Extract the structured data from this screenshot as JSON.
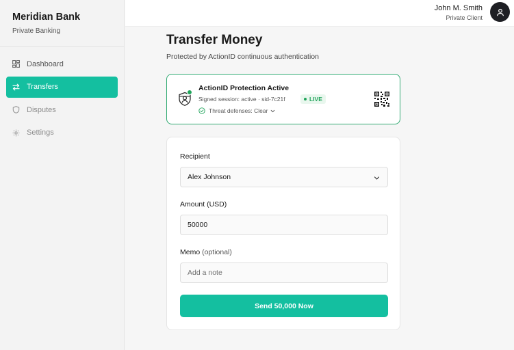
{
  "brand": {
    "name": "Meridian Bank",
    "tagline": "Private Banking"
  },
  "sidebar": {
    "items": [
      {
        "label": "Dashboard",
        "icon": "dashboard-grid-icon",
        "active": false
      },
      {
        "label": "Transfers",
        "icon": "transfer-arrows-icon",
        "active": true
      },
      {
        "label": "Disputes",
        "icon": "shield-icon",
        "active": false
      },
      {
        "label": "Settings",
        "icon": "gear-icon",
        "active": false
      }
    ]
  },
  "user": {
    "name": "John M. Smith",
    "role": "Private Client",
    "avatar_icon": "user-icon"
  },
  "page": {
    "title": "Transfer Money",
    "subtitle": "Protected by ActionID continuous authentication"
  },
  "protection": {
    "title": "ActionID Protection Active",
    "session": "Signed session: active · sid-7c21f",
    "badge": "LIVE",
    "defense": "Threat defenses: Clear",
    "icons": [
      "shield-person-icon",
      "check-circle-icon",
      "chevron-down-icon",
      "qr-code-icon"
    ]
  },
  "form": {
    "recipient_label": "Recipient",
    "recipient_value": "Alex Johnson",
    "amount_label": "Amount (USD)",
    "amount_value": "50000",
    "memo_label": "Memo",
    "memo_optional": "(optional)",
    "memo_placeholder": "Add a note",
    "memo_value": "",
    "submit_label": "Send 50,000 Now"
  },
  "colors": {
    "accent": "#14bfa0",
    "live_green": "#1fa35a",
    "protection_border": "#2fa971",
    "avatar_bg": "#1e1f24"
  }
}
